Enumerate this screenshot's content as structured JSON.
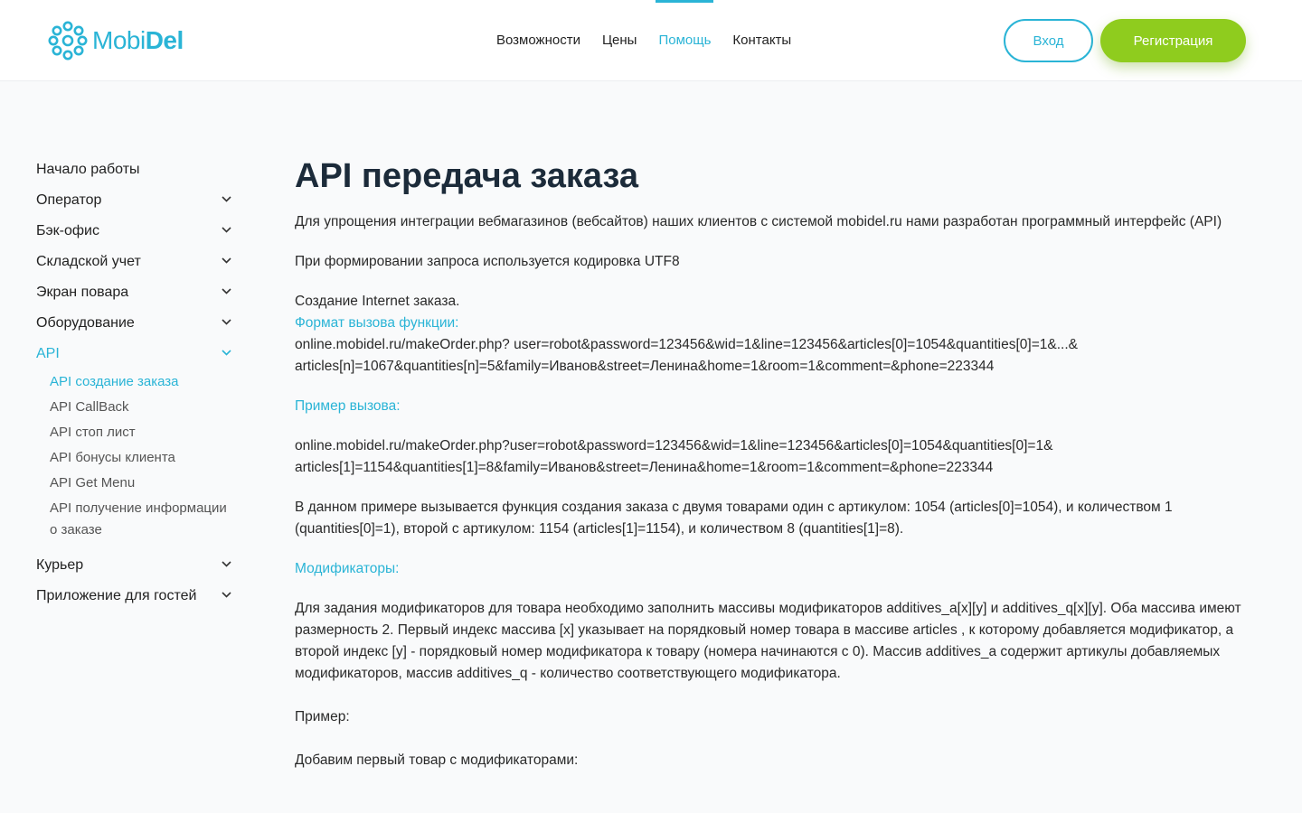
{
  "header": {
    "logo": {
      "part1": "Mobi",
      "part2": "Del"
    },
    "nav": [
      {
        "label": "Возможности",
        "active": false
      },
      {
        "label": "Цены",
        "active": false
      },
      {
        "label": "Помощь",
        "active": true
      },
      {
        "label": "Контакты",
        "active": false
      }
    ],
    "login_label": "Вход",
    "register_label": "Регистрация"
  },
  "sidebar": {
    "items": [
      {
        "label": "Начало работы",
        "chevron": false
      },
      {
        "label": "Оператор",
        "chevron": true
      },
      {
        "label": "Бэк-офис",
        "chevron": true
      },
      {
        "label": "Складской учет",
        "chevron": true
      },
      {
        "label": "Экран повара",
        "chevron": true
      },
      {
        "label": "Оборудование",
        "chevron": true
      },
      {
        "label": "API",
        "chevron": true,
        "active": true
      }
    ],
    "api_sub": [
      {
        "label": "API создание заказа",
        "active": true
      },
      {
        "label": "API CallBack"
      },
      {
        "label": "API стоп лист"
      },
      {
        "label": "API бонусы клиента"
      },
      {
        "label": "API Get Menu"
      },
      {
        "label": "API получение информации о заказе"
      }
    ],
    "items_after": [
      {
        "label": "Курьер",
        "chevron": true
      },
      {
        "label": "Приложение для гостей",
        "chevron": true
      }
    ]
  },
  "content": {
    "title": "API передача заказа",
    "intro": "Для упрощения интеграции вебмагазинов (вебсайтов) наших клиентов с системой mobidel.ru нами разработан программный интерфейс (API)",
    "encoding": "При формировании запроса используется кодировка UTF8",
    "create_heading": "Создание Internet заказа.",
    "format_label": "Формат вызова функции:",
    "format_url": "online.mobidel.ru/makeOrder.php? user=robot&password=123456&wid=1&line=123456&articles[0]=1054&quantities[0]=1&...& articles[n]=1067&quantities[n]=5&family=Иванов&street=Ленина&home=1&room=1&comment=&phone=223344",
    "example_label": "Пример вызова:",
    "example_url": "online.mobidel.ru/makeOrder.php?user=robot&password=123456&wid=1&line=123456&articles[0]=1054&quantities[0]=1& articles[1]=1154&quantities[1]=8&family=Иванов&street=Ленина&home=1&room=1&comment=&phone=223344",
    "example_desc": "В данном примере вызывается функция создания заказа с двумя товарами один с артикулом: 1054 (articles[0]=1054), и количеством 1 (quantities[0]=1), второй с артикулом: 1154 (articles[1]=1154), и количеством 8 (quantities[1]=8).",
    "modifiers_label": "Модификаторы:",
    "modifiers_desc": "Для задания модификаторов для товара необходимо заполнить массивы модификаторов additives_a[x][y] и additives_q[x][y]. Оба массива имеют размерность 2. Первый индекс массива [x] указывает на порядковый номер товара в массиве articles , к которому добавляется модификатор, а второй индекс [y] - порядковый номер модификатора к товару (номера начинаются с 0). Массив additives_a содержит артикулы добавляемых модификаторов, массив additives_q - количество соответствующего модификатора.",
    "example2": "Пример:",
    "add_first": "Добавим первый товар с модификаторами:"
  },
  "colors": {
    "accent": "#2ab4d6",
    "register": "#8fcc1e"
  }
}
